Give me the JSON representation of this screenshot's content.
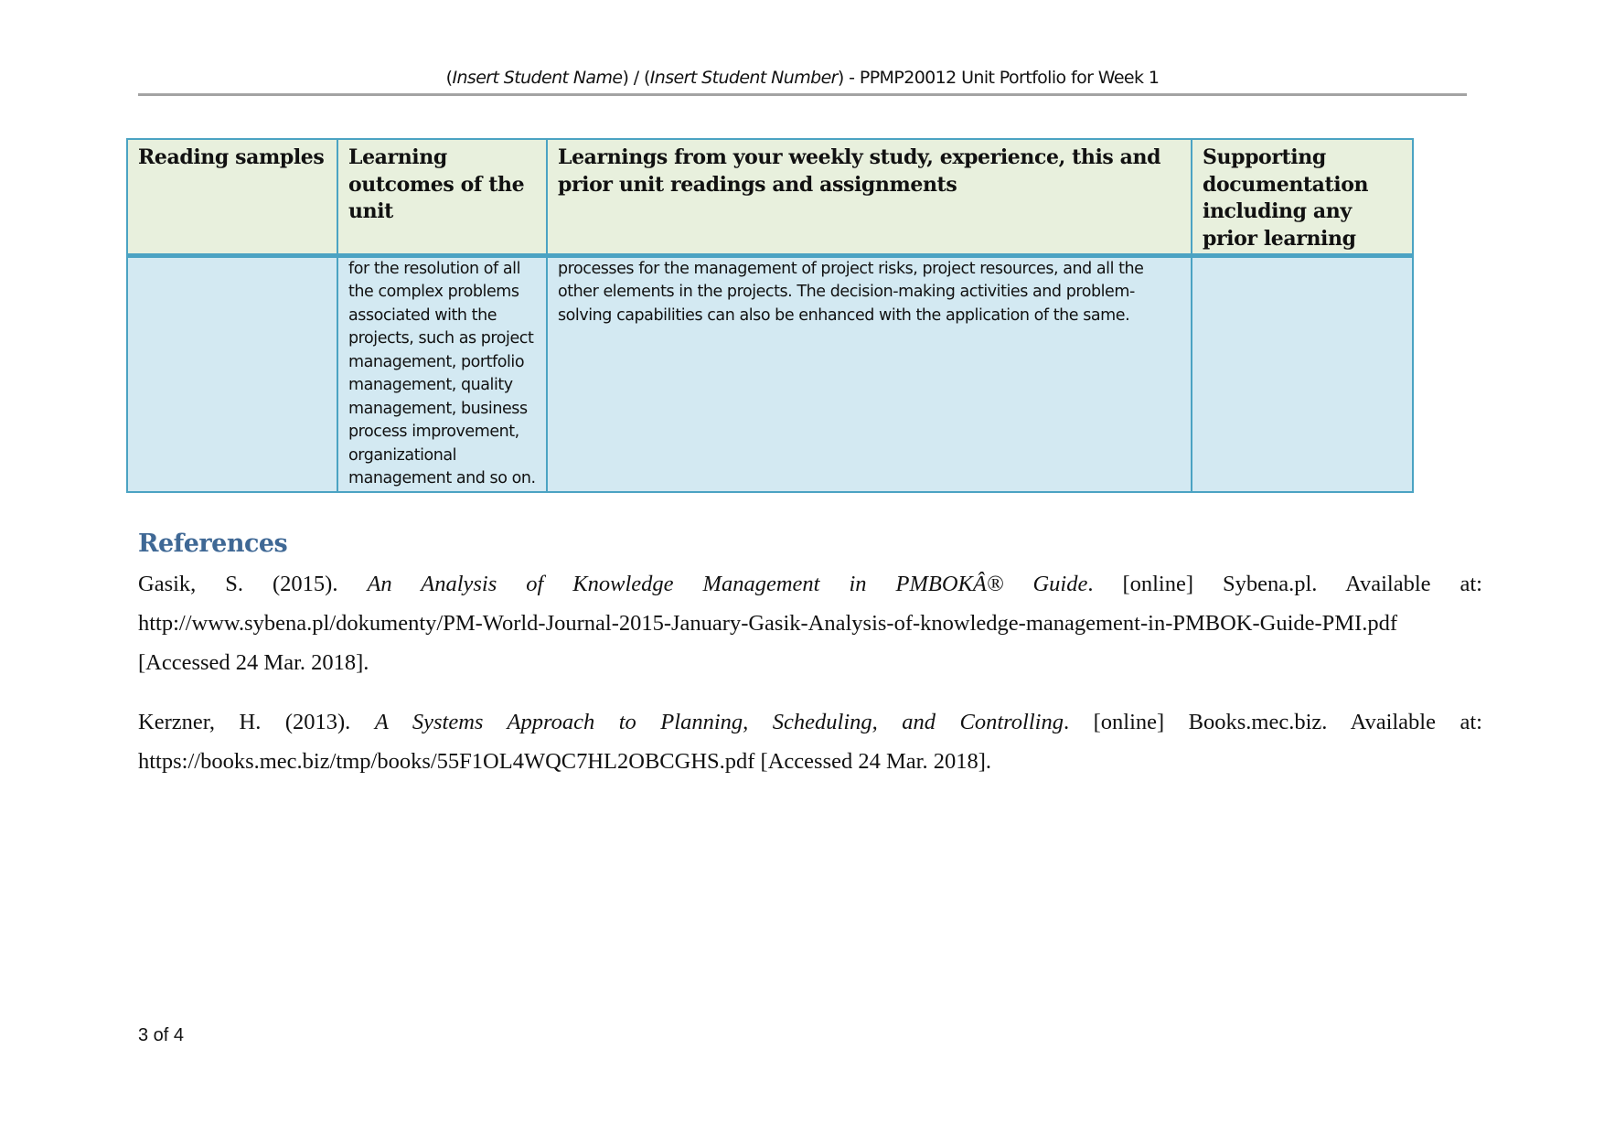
{
  "header": {
    "open_paren_1": "(",
    "student_name_placeholder": "Insert Student Name",
    "separator": ") / (",
    "student_number_placeholder": "Insert Student Number",
    "suffix": ") - PPMP20012 Unit Portfolio for Week 1"
  },
  "table": {
    "columns": [
      "Reading samples",
      "Learning outcomes of the unit",
      "Learnings from your weekly study, experience, this and prior unit readings and assignments",
      "Supporting documentation including any prior learning"
    ],
    "rows": [
      {
        "reading_samples": "",
        "learning_outcomes": "for the resolution of all the complex problems associated with the projects, such as project management, portfolio management, quality management, business process improvement, organizational management and so on.",
        "learnings": "processes for the management of project risks, project resources, and all the other elements in the projects. The decision-making activities and problem-solving capabilities can also be enhanced with the application of the same.",
        "supporting_documentation": ""
      }
    ]
  },
  "references": {
    "heading": "References",
    "entries": [
      {
        "authors_year": "Gasik, S. (2015). ",
        "title": "An Analysis of Knowledge Management in PMBOKÂ® Guide",
        "details": ". [online] Sybena.pl. Available at: http://www.sybena.pl/dokumenty/PM-World-Journal-2015-January-Gasik-Analysis-of-knowledge-management-in-PMBOK-Guide-PMI.pdf [Accessed 24 Mar. 2018]."
      },
      {
        "authors_year": "Kerzner, H. (2013). ",
        "title": "A Systems Approach to Planning, Scheduling, and Controlling",
        "details": ". [online] Books.mec.biz. Available at: https://books.mec.biz/tmp/books/55F1OL4WQC7HL2OBCGHS.pdf [Accessed 24 Mar. 2018]."
      }
    ]
  },
  "footer": {
    "page_number": "3 of 4"
  }
}
